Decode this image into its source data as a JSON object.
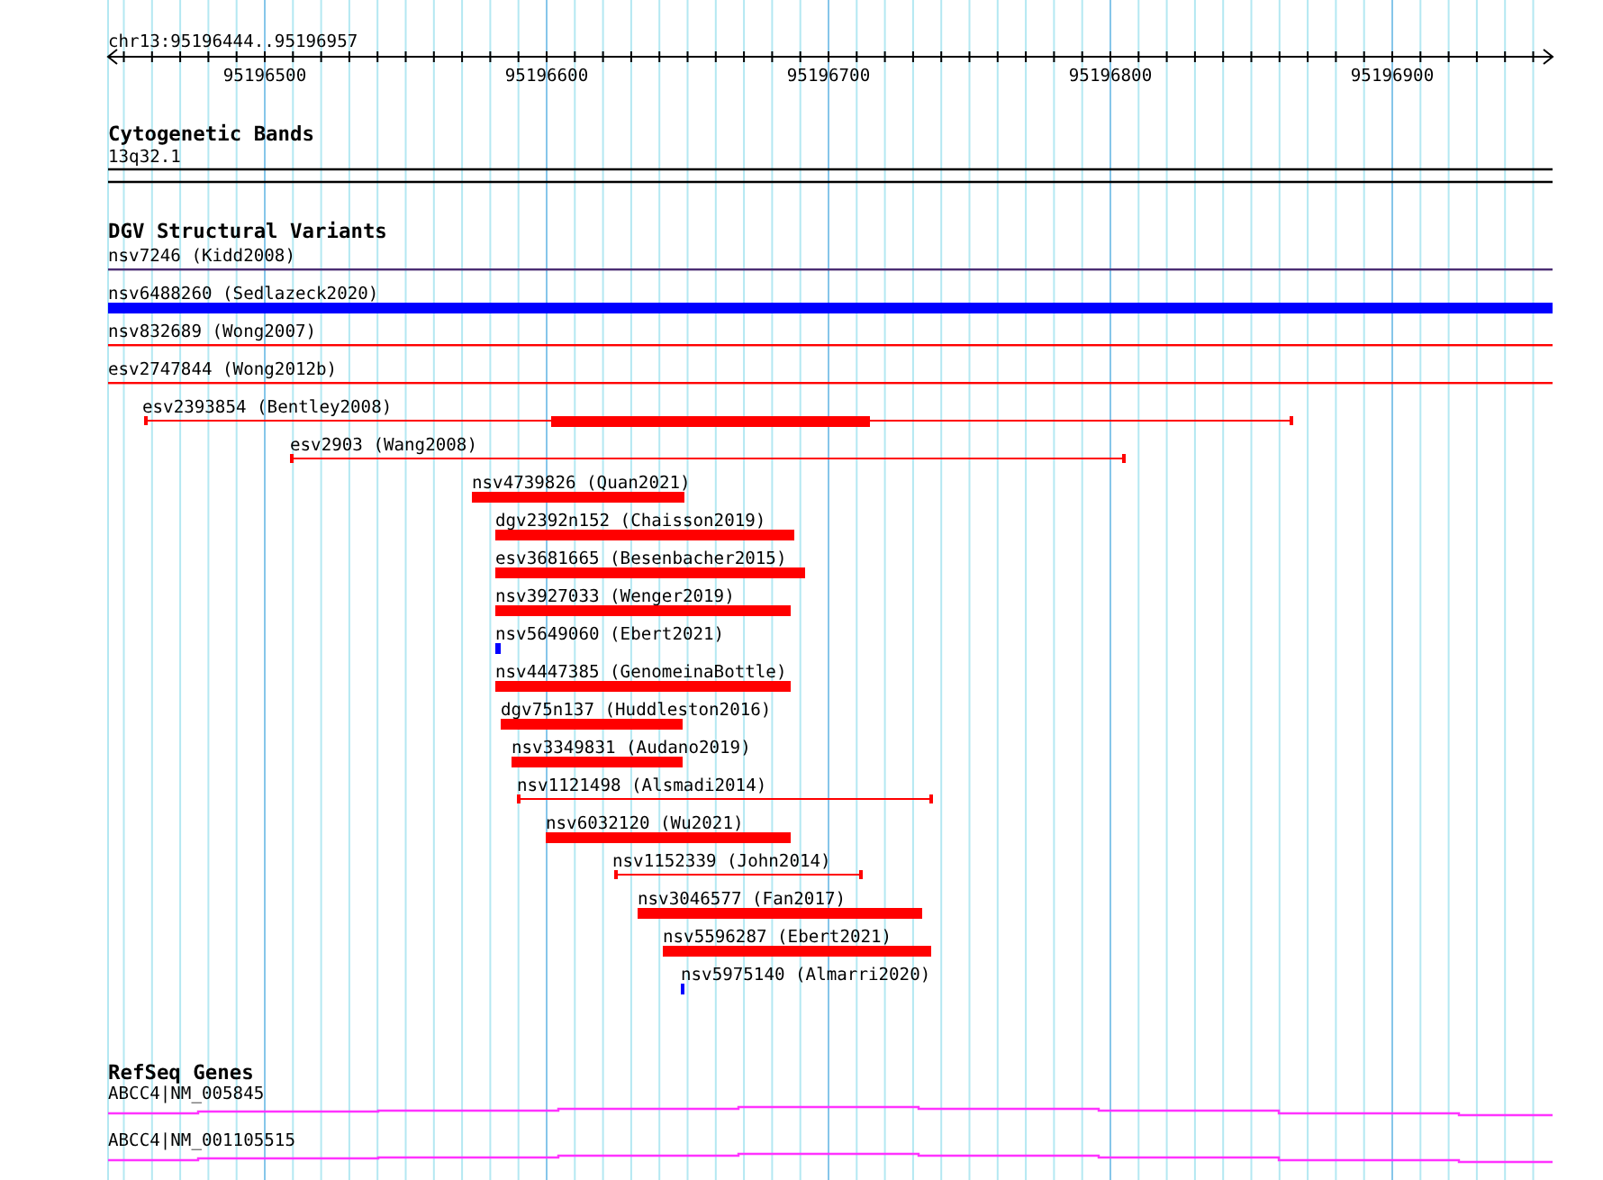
{
  "ruler": {
    "location": "chr13:95196444..95196957",
    "ticks": [
      "95196500",
      "95196600",
      "95196700",
      "95196800",
      "95196900"
    ]
  },
  "tracks": [
    {
      "title": "Cytogenetic Bands",
      "kind": "cytoband",
      "features": [
        {
          "label": "13q32.1"
        }
      ]
    },
    {
      "title": "DGV Structural Variants",
      "kind": "variants",
      "features": [
        {
          "label": "nsv7246 (Kidd2008)",
          "kind": "line",
          "color": "#4b2d73"
        },
        {
          "label": "nsv6488260 (Sedlazeck2020)",
          "kind": "bar",
          "color": "#0000ff"
        },
        {
          "label": "nsv832689 (Wong2007)",
          "kind": "line",
          "color": "#ff0000"
        },
        {
          "label": "esv2747844 (Wong2012b)",
          "kind": "line",
          "color": "#ff0000"
        },
        {
          "label": "esv2393854 (Bentley2008)",
          "kind": "span-core",
          "color": "#ff0000"
        },
        {
          "label": "esv2903 (Wang2008)",
          "kind": "span",
          "color": "#ff0000"
        },
        {
          "label": "nsv4739826 (Quan2021)",
          "kind": "bar",
          "color": "#ff0000"
        },
        {
          "label": "dgv2392n152 (Chaisson2019)",
          "kind": "bar",
          "color": "#ff0000"
        },
        {
          "label": "esv3681665 (Besenbacher2015)",
          "kind": "bar",
          "color": "#ff0000"
        },
        {
          "label": "nsv3927033 (Wenger2019)",
          "kind": "bar",
          "color": "#ff0000"
        },
        {
          "label": "nsv5649060 (Ebert2021)",
          "kind": "bar",
          "color": "#0000ff"
        },
        {
          "label": "nsv4447385 (GenomeinaBottle)",
          "kind": "bar",
          "color": "#ff0000"
        },
        {
          "label": "dgv75n137 (Huddleston2016)",
          "kind": "bar",
          "color": "#ff0000"
        },
        {
          "label": "nsv3349831 (Audano2019)",
          "kind": "bar",
          "color": "#ff0000"
        },
        {
          "label": "nsv1121498 (Alsmadi2014)",
          "kind": "span",
          "color": "#ff0000"
        },
        {
          "label": "nsv6032120 (Wu2021)",
          "kind": "bar",
          "color": "#ff0000"
        },
        {
          "label": "nsv1152339 (John2014)",
          "kind": "span",
          "color": "#ff0000"
        },
        {
          "label": "nsv3046577 (Fan2017)",
          "kind": "bar",
          "color": "#ff0000"
        },
        {
          "label": "nsv5596287 (Ebert2021)",
          "kind": "bar",
          "color": "#ff0000"
        },
        {
          "label": "nsv5975140 (Almarri2020)",
          "kind": "bar",
          "color": "#0000ff"
        }
      ]
    },
    {
      "title": "RefSeq Genes",
      "kind": "genes",
      "features": [
        {
          "label": "ABCC4|NM_005845",
          "color": "#ff33ff"
        },
        {
          "label": "ABCC4|NM_001105515",
          "color": "#ff33ff"
        }
      ]
    }
  ]
}
